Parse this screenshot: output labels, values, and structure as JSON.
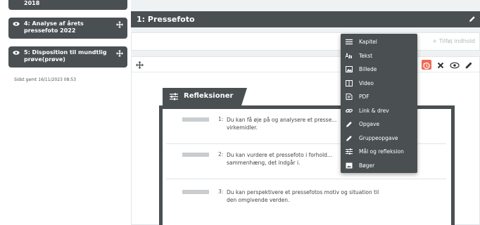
{
  "sidebar": {
    "items": [
      {
        "label": "2018",
        "icon": "eye-icon"
      },
      {
        "label": "4: Analyse af årets pressefoto 2022",
        "icon": "eye-icon"
      },
      {
        "label": "5: Disposition til mundtlig prøve(prøve)",
        "icon": "eye-icon"
      }
    ],
    "saved_text": "Sidst gemt 16/11/2023 08:53"
  },
  "section": {
    "title": "1:  Pressefoto",
    "add_content_label": "Tilføj indhold"
  },
  "reflection": {
    "title": "Refleksioner",
    "questions": [
      {
        "num": "1:",
        "text": "Du kan få øje på og analysere et presse... virkemidler."
      },
      {
        "num": "2:",
        "text": "Du kan vurdere et pressefoto i forhold... sammenhæng, det indgår i."
      },
      {
        "num": "3:",
        "text": "Du kan perspektivere et pressefotos motiv og situation til den omgivende verden."
      }
    ]
  },
  "menu": {
    "items": [
      {
        "label": "Kapitel",
        "icon": "list-icon"
      },
      {
        "label": "Tekst",
        "icon": "text-icon"
      },
      {
        "label": "Billede",
        "icon": "image-icon"
      },
      {
        "label": "Video",
        "icon": "video-icon"
      },
      {
        "label": "PDF",
        "icon": "pdf-icon"
      },
      {
        "label": "Link & drev",
        "icon": "link-icon"
      },
      {
        "label": "Opgave",
        "icon": "pencil-icon"
      },
      {
        "label": "Gruppeopgave",
        "icon": "pencil-icon"
      },
      {
        "label": "Mål og refleksion",
        "icon": "sliders-icon"
      },
      {
        "label": "Bøger",
        "icon": "book-icon"
      }
    ]
  },
  "colors": {
    "dark": "#4a4f52",
    "accent": "#f06a55",
    "background": "#dde3e6"
  }
}
